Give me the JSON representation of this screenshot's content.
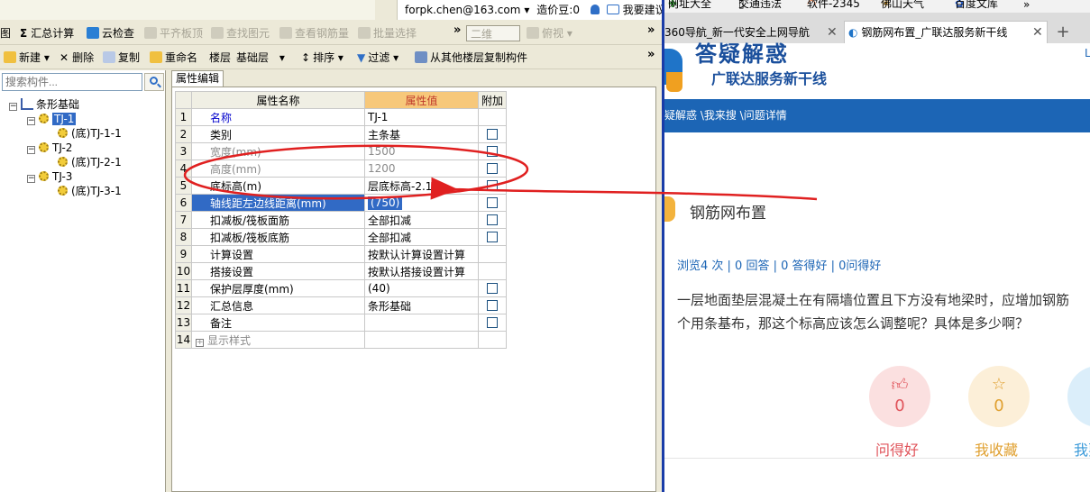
{
  "app": {
    "account": "forpk.chen@163.com",
    "account_arrow": "▾",
    "beans": "造价豆:0",
    "suggest": "我要建议",
    "toolbar1": {
      "item_left": "图",
      "summary": "汇总计算",
      "cloud": "云检查",
      "align_slab": "平齐板顶",
      "find_elem": "查找图元",
      "view_rebar": "查看钢筋量",
      "batch_select": "批量选择",
      "view_2d": "二维",
      "view_top": "俯视",
      "more": "»"
    },
    "toolbar2": {
      "new": "新建",
      "delete": "删除",
      "copy": "复制",
      "rename": "重命名",
      "floor_label": "楼层",
      "floor_value": "基础层",
      "sort": "排序",
      "filter": "过滤",
      "copy_from": "从其他楼层复制构件",
      "more": "»"
    },
    "search_placeholder": "搜索构件...",
    "tree": {
      "root": "条形基础",
      "items": [
        {
          "label": "TJ-1",
          "child": "(底)TJ-1-1"
        },
        {
          "label": "TJ-2",
          "child": "(底)TJ-2-1"
        },
        {
          "label": "TJ-3",
          "child": "(底)TJ-3-1"
        }
      ]
    },
    "panel": {
      "tab": "属性编辑",
      "headers": [
        "属性名称",
        "属性值",
        "附加"
      ],
      "rows": [
        {
          "n": "1",
          "name": "名称",
          "value": "TJ-1"
        },
        {
          "n": "2",
          "name": "类别",
          "value": "主条基"
        },
        {
          "n": "3",
          "name": "宽度(mm)",
          "value": "1500"
        },
        {
          "n": "4",
          "name": "高度(mm)",
          "value": "1200"
        },
        {
          "n": "5",
          "name": "底标高(m)",
          "value": "层底标高-2.1"
        },
        {
          "n": "6",
          "name": "轴线距左边线距离(mm)",
          "value": "(750)"
        },
        {
          "n": "7",
          "name": "扣减板/筏板面筋",
          "value": "全部扣减"
        },
        {
          "n": "8",
          "name": "扣减板/筏板底筋",
          "value": "全部扣减"
        },
        {
          "n": "9",
          "name": "计算设置",
          "value": "按默认计算设置计算"
        },
        {
          "n": "10",
          "name": "搭接设置",
          "value": "按默认搭接设置计算"
        },
        {
          "n": "11",
          "name": "保护层厚度(mm)",
          "value": "(40)"
        },
        {
          "n": "12",
          "name": "汇总信息",
          "value": "条形基础"
        },
        {
          "n": "13",
          "name": "备注",
          "value": ""
        },
        {
          "n": "14",
          "name": "显示样式",
          "value": ""
        }
      ]
    }
  },
  "browser": {
    "favorites": [
      "网址大全",
      "交通违法",
      "软件-2345",
      "佛山天气",
      "百度文库",
      "»"
    ],
    "tabs": [
      {
        "title": "360导航_新一代安全上网导航"
      },
      {
        "title": "钢筋网布置_广联达服务新干线"
      }
    ],
    "new_tab": "+",
    "logo_title": "答疑解惑",
    "logo_sub": "广联达服务新干线",
    "nav": "疑解惑 \\我来搜 \\问题详情",
    "question_title": "钢筋网布置",
    "stats": "浏览4 次 | 0 回答 | 0 答得好 | 0问得好",
    "body_line1": "一层地面垫层混凝土在有隔墙位置且下方没有地梁时，应增加钢筋",
    "body_line2": "个用条基布，那这个标高应该怎么调整呢？具体是多少啊？",
    "actions": [
      {
        "label": "问得好",
        "count": "0",
        "color": "#e0545b",
        "bg": "#fbe0e0"
      },
      {
        "label": "我收藏",
        "count": "0",
        "color": "#e0a030",
        "bg": "#fcefd8"
      },
      {
        "label": "我要",
        "count": "",
        "color": "#3b9ad9",
        "bg": "#dbeefa"
      }
    ]
  },
  "colors": {
    "selection": "#316ac5",
    "header_value": "#f7c87a",
    "annotation": "#e02020",
    "nav_blue": "#1c65b5"
  }
}
